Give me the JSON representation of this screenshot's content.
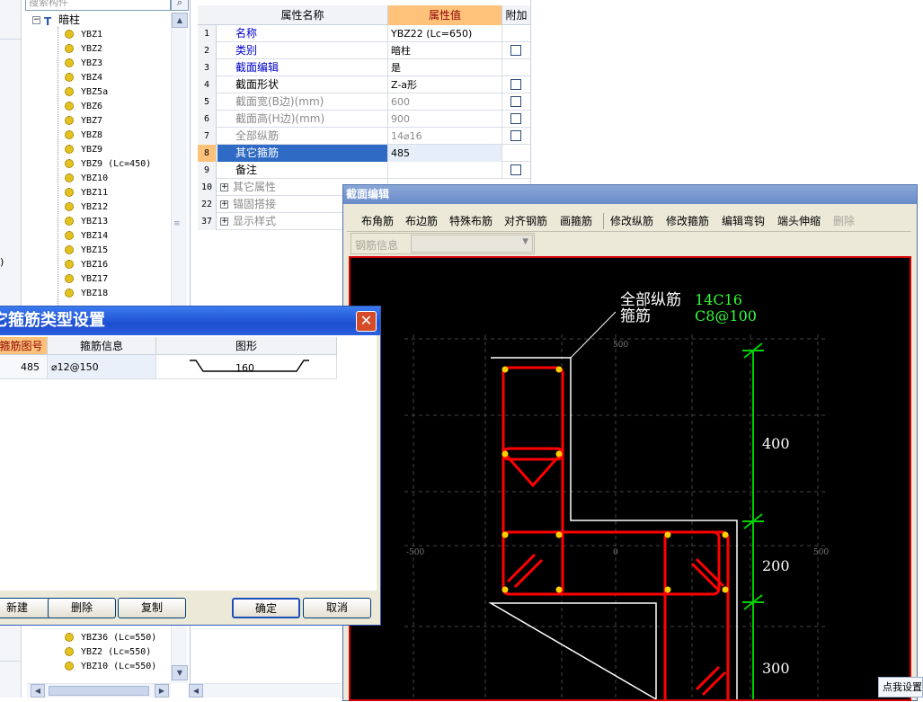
{
  "search": {
    "placeholder": "搜索构件",
    "btn_icon": "search-icon"
  },
  "tree": {
    "root_label": "暗柱",
    "items_top": [
      "YBZ1",
      "YBZ2",
      "YBZ3",
      "YBZ4",
      "YBZ5a",
      "YBZ6",
      "YBZ7",
      "YBZ8",
      "YBZ9",
      "YBZ9 (Lc=450)",
      "YBZ10",
      "YBZ11",
      "YBZ12",
      "YBZ13",
      "YBZ14",
      "YBZ15",
      "YBZ16",
      "YBZ17",
      "YBZ18"
    ],
    "items_bottom": [
      "YBZ36 (Lc=550)",
      "YBZ2 (Lc=550)",
      "YBZ10 (Lc=550)"
    ]
  },
  "prop_grid": {
    "headers": {
      "name": "属性名称",
      "value": "属性值",
      "extra": "附加"
    },
    "rows": [
      {
        "num": "1",
        "name": "名称",
        "value": "YBZ22 (Lc=650)",
        "style": "blue",
        "check": false
      },
      {
        "num": "2",
        "name": "类别",
        "value": "暗柱",
        "style": "blue",
        "check": true
      },
      {
        "num": "3",
        "name": "截面编辑",
        "value": "是",
        "style": "blue",
        "check": false
      },
      {
        "num": "4",
        "name": "截面形状",
        "value": "Z-a形",
        "style": "black",
        "check": true
      },
      {
        "num": "5",
        "name": "截面宽(B边)(mm)",
        "value": "600",
        "style": "gray",
        "check": true
      },
      {
        "num": "6",
        "name": "截面高(H边)(mm)",
        "value": "900",
        "style": "gray",
        "check": true
      },
      {
        "num": "7",
        "name": "全部纵筋",
        "value": "14⌀16",
        "style": "gray",
        "check": true
      },
      {
        "num": "8",
        "name": "其它箍筋",
        "value": "485",
        "style": "selected",
        "check": false
      },
      {
        "num": "9",
        "name": "备注",
        "value": "",
        "style": "black",
        "check": true
      },
      {
        "num": "10",
        "name": "其它属性",
        "value": "",
        "style": "group",
        "check": false
      },
      {
        "num": "22",
        "name": "锚固搭接",
        "value": "",
        "style": "group",
        "check": false
      },
      {
        "num": "37",
        "name": "显示样式",
        "value": "",
        "style": "group",
        "check": false
      }
    ]
  },
  "section_editor": {
    "title": "截面编辑",
    "toolbar": [
      "布角筋",
      "布边筋",
      "特殊布筋",
      "对齐钢筋",
      "画箍筋",
      "修改纵筋",
      "修改箍筋",
      "编辑弯钩",
      "端头伸缩",
      "删除"
    ],
    "rebar_info_label": "钢筋信息",
    "annot_labels": [
      "全部纵筋",
      "箍筋"
    ],
    "annot_values": [
      "14C16",
      "C8@100"
    ],
    "dims": [
      "400",
      "200",
      "300"
    ],
    "axis_ticks": {
      "top": "500",
      "left": "-500",
      "center": "0",
      "right": "500"
    }
  },
  "dialog": {
    "title": "它箍筋类型设置",
    "headers": [
      "箍筋图号",
      "箍筋信息",
      "图形"
    ],
    "row": {
      "code": "485",
      "info": "⌀12@150",
      "shape_value": "160"
    },
    "buttons": {
      "new": "新建",
      "delete": "删除",
      "copy": "复制",
      "ok": "确定",
      "cancel": "取消"
    }
  },
  "status_tip": "点我设置",
  "colors": {
    "selection": "#2f6bc5",
    "title_blue": "#1d4fd0",
    "rebar_red": "#ff0000",
    "dim_green": "#00d000",
    "annot_green": "#33ff33"
  }
}
